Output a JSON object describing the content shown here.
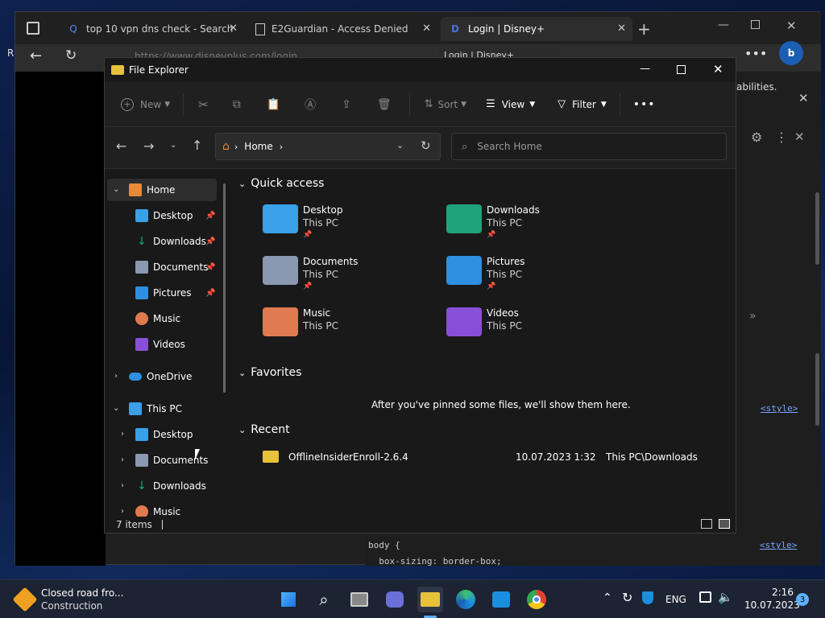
{
  "browser": {
    "tabs": [
      {
        "title": "top 10 vpn dns check - Search"
      },
      {
        "title": "E2Guardian - Access Denied"
      },
      {
        "title": "Login | Disney+"
      }
    ],
    "address": "https://www.disneyplus.com/login",
    "tooltip": "Login | Disney+",
    "side_letter": "R",
    "banner_text": "abilities.",
    "devtools": {
      "style_link_1": "<style>",
      "style_link_2": "<style>",
      "code_line_1": "body {",
      "code_line_2": "  box-sizing: border-box;"
    }
  },
  "explorer": {
    "title": "File Explorer",
    "toolbar": {
      "new": "New",
      "sort": "Sort",
      "view": "View",
      "filter": "Filter"
    },
    "breadcrumb": "Home",
    "search_placeholder": "Search Home",
    "sidebar": {
      "home": "Home",
      "pinned": [
        {
          "label": "Desktop"
        },
        {
          "label": "Downloads"
        },
        {
          "label": "Documents"
        },
        {
          "label": "Pictures"
        }
      ],
      "music": "Music",
      "videos": "Videos",
      "onedrive": "OneDrive",
      "thispc": "This PC",
      "pc_items": [
        {
          "label": "Desktop"
        },
        {
          "label": "Documents"
        },
        {
          "label": "Downloads"
        },
        {
          "label": "Music"
        }
      ]
    },
    "quick_access": {
      "heading": "Quick access",
      "items": [
        {
          "name": "Desktop",
          "location": "This PC"
        },
        {
          "name": "Downloads",
          "location": "This PC"
        },
        {
          "name": "Documents",
          "location": "This PC"
        },
        {
          "name": "Pictures",
          "location": "This PC"
        },
        {
          "name": "Music",
          "location": "This PC"
        },
        {
          "name": "Videos",
          "location": "This PC"
        }
      ]
    },
    "favorites": {
      "heading": "Favorites",
      "empty_text": "After you've pinned some files, we'll show them here."
    },
    "recent": {
      "heading": "Recent",
      "items": [
        {
          "name": "OfflineInsiderEnroll-2.6.4",
          "date": "10.07.2023 1:32",
          "location": "This PC\\Downloads"
        }
      ]
    },
    "status": "7 items"
  },
  "taskbar": {
    "weather_title": "Closed road fro...",
    "weather_sub": "Construction",
    "language": "ENG",
    "time": "2:16",
    "date": "10.07.2023",
    "notifications": "3"
  },
  "colors": {
    "desktop_folder": "#3aa0e8",
    "downloads_folder": "#1fa37a",
    "documents_folder": "#8a98b0",
    "pictures_folder": "#2f8fe0",
    "music_folder": "#e07a50",
    "videos_folder": "#8a4fd8",
    "zip_folder": "#e8c13a"
  }
}
